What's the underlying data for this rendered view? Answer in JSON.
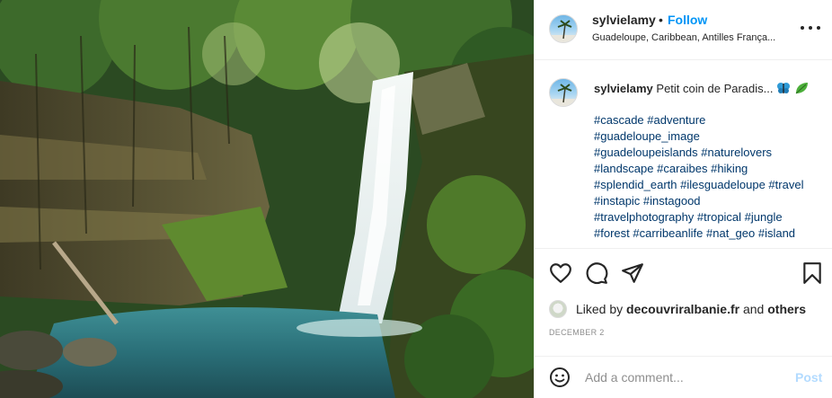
{
  "post": {
    "username": "sylvielamy",
    "separator": "•",
    "follow_label": "Follow",
    "location": "Guadeloupe, Caribbean, Antilles França...",
    "caption_text": "Petit coin de Paradis...",
    "caption_emojis": [
      "butterfly-icon",
      "leaf-icon"
    ],
    "hashtag_lines": [
      "#cascade #adventure",
      "#guadeloupe_image",
      "#guadeloupeislands #naturelovers",
      "#landscape #caraibes #hiking",
      "#splendid_earth #ilesguadeloupe #travel",
      "#instapic #instagood",
      "#travelphotography #tropical #jungle",
      "#forest #carribeanlife #nat_geo #island"
    ],
    "likes": {
      "prefix": "Liked by",
      "liker": "decouvriralbanie.fr",
      "conjunction": "and",
      "others": "others"
    },
    "date": "DECEMBER 2"
  },
  "comment": {
    "placeholder": "Add a comment...",
    "post_label": "Post"
  },
  "icons": {
    "actions": [
      "heart-icon",
      "comment-icon",
      "share-icon",
      "bookmark-icon"
    ],
    "header_more": "more-options-icon",
    "emoji_picker": "smiley-icon"
  },
  "colors": {
    "accent": "#0095f6",
    "hashtag": "#00376b",
    "post_disabled": "#b3dbff",
    "muted": "#8e8e8e"
  }
}
